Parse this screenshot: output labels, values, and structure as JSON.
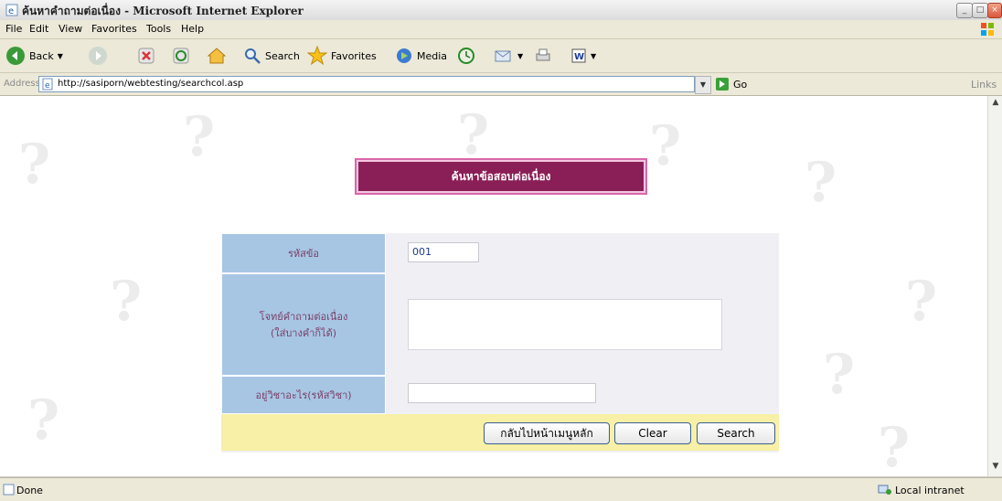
{
  "window": {
    "title": "ค้นหาคำถามต่อเนื่อง - Microsoft Internet Explorer"
  },
  "menu": {
    "items": [
      {
        "label": "File"
      },
      {
        "label": "Edit"
      },
      {
        "label": "View"
      },
      {
        "label": "Favorites"
      },
      {
        "label": "Tools"
      },
      {
        "label": "Help"
      }
    ]
  },
  "toolbar": {
    "back_label": "Back",
    "search_label": "Search",
    "favorites_label": "Favorites",
    "media_label": "Media"
  },
  "address": {
    "label": "Address",
    "url": "http://sasiporn/webtesting/searchcol.asp",
    "go_label": "Go",
    "links_label": "Links"
  },
  "page": {
    "heading": "ค้นหาข้อสอบต่อเนื่อง",
    "form": {
      "fields": [
        {
          "label": "รหัสข้อ",
          "value": "001"
        },
        {
          "label_line1": "โจทย์คำถามต่อเนื่อง",
          "label_line2": "(ใส่บางคำก็ได้)",
          "value": ""
        },
        {
          "label": "อยู่วิชาอะไร(รหัสวิชา)",
          "value": ""
        }
      ],
      "buttons": {
        "home": "กลับไปหน้าเมนูหลัก",
        "clear": "Clear",
        "search": "Search"
      }
    }
  },
  "status": {
    "text": "Done",
    "zone": "Local intranet"
  },
  "colors": {
    "heading_bg": "#8a1e56",
    "label_bg": "#a7c6e4",
    "button_row_bg": "#f7f0a6"
  }
}
